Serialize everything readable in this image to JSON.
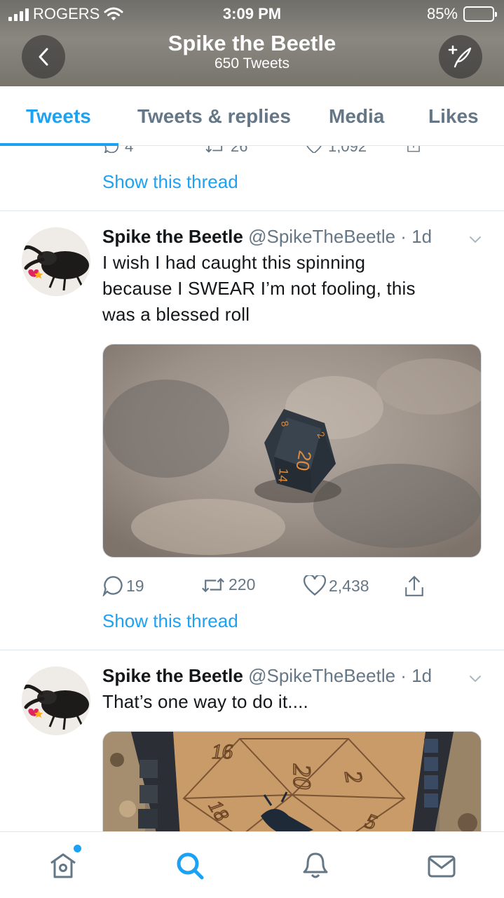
{
  "status_bar": {
    "carrier": "ROGERS",
    "time": "3:09 PM",
    "battery": "85%",
    "battery_level": 0.85
  },
  "header": {
    "title": "Spike the Beetle",
    "subtitle": "650 Tweets"
  },
  "tabs": [
    {
      "label": "Tweets",
      "active": true
    },
    {
      "label": "Tweets & replies",
      "active": false
    },
    {
      "label": "Media",
      "active": false
    },
    {
      "label": "Likes",
      "active": false
    }
  ],
  "prev_tweet": {
    "replies": "4",
    "retweets": "26",
    "likes": "1,092",
    "show_thread": "Show this thread"
  },
  "tweets": [
    {
      "name": "Spike the Beetle",
      "handle": "@SpikeTheBeetle",
      "sep": "·",
      "time": "1d",
      "text_lines": [
        "I wish I had caught this spinning",
        "because I SWEAR I’m not fooling, this",
        "was a blessed roll"
      ],
      "media_die_numbers": [
        "20",
        "14",
        "8",
        "2"
      ],
      "replies": "19",
      "retweets": "220",
      "likes": "2,438",
      "show_thread": "Show this thread"
    },
    {
      "name": "Spike the Beetle",
      "handle": "@SpikeTheBeetle",
      "sep": "·",
      "time": "1d",
      "text_lines": [
        "That’s one way to do it...."
      ],
      "media_board_numbers": [
        "16",
        "20",
        "18",
        "2",
        "5"
      ]
    }
  ],
  "icons": {
    "back": "chevron-left-icon",
    "compose": "compose-tweet-icon",
    "reply": "reply-icon",
    "retweet": "retweet-icon",
    "like": "heart-icon",
    "share": "share-icon",
    "home": "home-icon",
    "search": "search-icon",
    "notifications": "bell-icon",
    "messages": "mail-icon"
  },
  "colors": {
    "accent": "#1da1f2",
    "secondary_text": "#657786",
    "divider": "#e1e8ed"
  }
}
